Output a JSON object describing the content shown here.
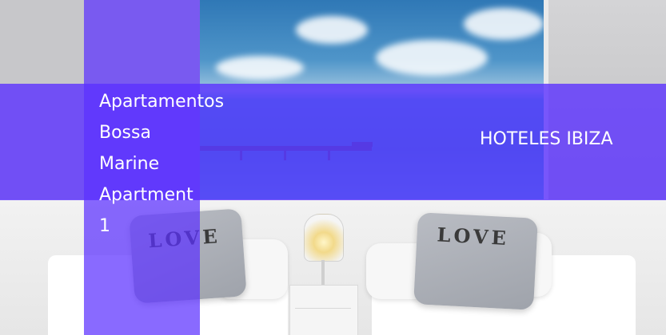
{
  "hero": {
    "title_lines": [
      "Apartamentos",
      "Bossa",
      "Marine",
      "Apartment",
      "1"
    ],
    "brand_label": "HOTELES IBIZA",
    "pillow_text": [
      "LOVE",
      "LOVE"
    ]
  },
  "colors": {
    "overlay": "#5b31ff",
    "text": "#ffffff",
    "heart_letter": "#c0392b"
  }
}
